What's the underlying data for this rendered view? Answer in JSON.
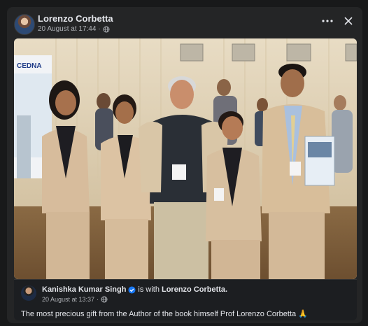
{
  "post": {
    "author": "Lorenzo Corbetta",
    "timestamp": "20 August at 17:44",
    "privacy_icon": "globe-icon"
  },
  "photo": {
    "sign_text": "CEDNA"
  },
  "shared": {
    "author": "Kanishka Kumar Singh",
    "with_text": "is with",
    "tagged": "Lorenzo Corbetta.",
    "timestamp": "20 August at 13:37",
    "caption": "The most precious gift from the Author of the book himself Prof Lorenzo Corbetta 🙏"
  },
  "colors": {
    "background": "#18191a",
    "card": "#242526",
    "verified": "#1877f2",
    "secondary_text": "#b0b3b8"
  }
}
